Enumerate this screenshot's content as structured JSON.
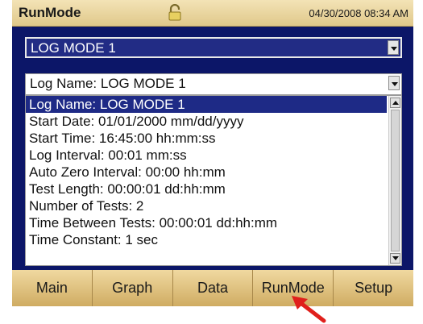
{
  "titlebar": {
    "app_title": "RunMode",
    "datetime": "04/30/2008 08:34 AM",
    "icon": "lock-icon"
  },
  "mode_select": {
    "value": "LOG MODE 1"
  },
  "log_select": {
    "value": "Log Name: LOG MODE 1"
  },
  "log_list": {
    "selected_index": 0,
    "items": [
      "Log Name: LOG MODE 1",
      "Start Date: 01/01/2000 mm/dd/yyyy",
      "Start Time: 16:45:00 hh:mm:ss",
      "Log Interval: 00:01 mm:ss",
      "Auto Zero Interval: 00:00 hh:mm",
      "Test Length: 00:00:01 dd:hh:mm",
      "Number of Tests: 2",
      "Time Between Tests: 00:00:01 dd:hh:mm",
      "Time Constant: 1 sec"
    ]
  },
  "tabs": [
    {
      "label": "Main"
    },
    {
      "label": "Graph"
    },
    {
      "label": "Data"
    },
    {
      "label": "RunMode"
    },
    {
      "label": "Setup"
    }
  ],
  "colors": {
    "panel_bg": "#0c1668",
    "selection": "#1e2a86",
    "tab_gold": "#d4b46b",
    "pointer_arrow": "#e0201c"
  }
}
